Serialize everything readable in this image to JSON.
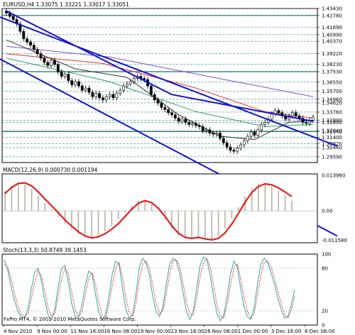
{
  "chart_data": [
    {
      "type": "candlestick",
      "title": "EURUSD,H4  1.33075 1.33221 1.33017 1.33051",
      "price_labels": [
        "1.43430",
        "1.42780",
        "1.41690",
        "1.40990",
        "1.40370",
        "1.39220",
        "1.38230",
        "1.37530",
        "1.36550",
        "1.35700",
        "1.34960",
        "1.34620",
        "1.33760",
        "1.32990",
        "1.32800",
        "1.32040",
        "1.31940",
        "1.31400",
        "1.30820",
        "1.30440",
        "1.29590"
      ],
      "highlighted_labels": [
        "1.42780",
        "1.37530",
        "1.33051",
        "1.31940"
      ],
      "current_price": "1.33051",
      "ylim": [
        1.2905,
        1.4343
      ],
      "x_labels": [
        "4 Nov 2010",
        "9 Nov 00:00",
        "11 Nov 16:00",
        "16 Nov 08:00",
        "19 Nov 00:00",
        "23 Nov 16:00",
        "26 Nov 08:00",
        "1 Dec 00:00",
        "3 Dec 16:00",
        "8 Dec 08:00"
      ],
      "close_series": [
        1.43,
        1.427,
        1.424,
        1.42,
        1.413,
        1.406,
        1.403,
        1.4,
        1.396,
        1.392,
        1.388,
        1.384,
        1.381,
        1.386,
        1.382,
        1.375,
        1.371,
        1.373,
        1.367,
        1.363,
        1.366,
        1.362,
        1.358,
        1.36,
        1.356,
        1.352,
        1.355,
        1.351,
        1.349,
        1.352,
        1.354,
        1.351,
        1.355,
        1.358,
        1.362,
        1.364,
        1.366,
        1.369,
        1.371,
        1.369,
        1.368,
        1.362,
        1.354,
        1.349,
        1.346,
        1.342,
        1.34,
        1.337,
        1.335,
        1.332,
        1.329,
        1.331,
        1.328,
        1.326,
        1.327,
        1.325,
        1.324,
        1.32,
        1.321,
        1.318,
        1.317,
        1.318,
        1.313,
        1.309,
        1.305,
        1.302,
        1.301,
        1.304,
        1.307,
        1.311,
        1.315,
        1.319,
        1.316,
        1.321,
        1.326,
        1.328,
        1.331,
        1.336,
        1.339,
        1.337,
        1.334,
        1.331,
        1.334,
        1.337,
        1.334,
        1.332,
        1.328,
        1.327,
        1.33,
        1.333
      ],
      "channel_lines": [
        {
          "color": "#1515c8",
          "points": [
            [
              0,
              1.424
            ],
            [
              89,
              1.3145
            ]
          ]
        },
        {
          "color": "#1515c8",
          "points": [
            [
              0,
              1.384
            ],
            [
              53,
              1.2945
            ]
          ]
        },
        {
          "color": "#1515c8",
          "points": [
            [
              0,
              1.432
            ],
            [
              48,
              1.354
            ],
            [
              89,
              1.329
            ]
          ]
        }
      ],
      "moving_averages": [
        {
          "color": "#7a4fd0",
          "points": [
            [
              0,
              1.399
            ],
            [
              30,
              1.389
            ],
            [
              60,
              1.37
            ],
            [
              89,
              1.352
            ]
          ]
        },
        {
          "color": "#d23a3a",
          "points": [
            [
              0,
              1.392
            ],
            [
              28,
              1.383
            ],
            [
              55,
              1.36
            ],
            [
              75,
              1.338
            ],
            [
              89,
              1.332
            ]
          ]
        },
        {
          "color": "#2e9e6b",
          "points": [
            [
              0,
              1.388
            ],
            [
              30,
              1.366
            ],
            [
              55,
              1.338
            ],
            [
              75,
              1.324
            ],
            [
              89,
              1.326
            ]
          ]
        },
        {
          "color": "#333333",
          "points": [
            [
              0,
              1.405
            ],
            [
              20,
              1.378
            ],
            [
              35,
              1.37
            ],
            [
              50,
              1.335
            ],
            [
              62,
              1.315
            ],
            [
              72,
              1.312
            ],
            [
              82,
              1.328
            ],
            [
              89,
              1.33
            ]
          ]
        }
      ]
    },
    {
      "type": "histogram_line",
      "title": "MACD(12,26,9)  0.000730 0.001194",
      "axis_labels": [
        "0.013960",
        "0.00",
        "-0.011580"
      ],
      "ylim": [
        -0.0125,
        0.0145
      ],
      "signal": [
        0.0068,
        0.0092,
        0.0108,
        0.011,
        0.0098,
        0.0074,
        0.0046,
        0.002,
        -0.0008,
        -0.0036,
        -0.006,
        -0.0082,
        -0.0098,
        -0.0106,
        -0.0102,
        -0.009,
        -0.0072,
        -0.005,
        -0.0022,
        0.0006,
        0.003,
        0.004,
        0.0032,
        0.001,
        -0.0022,
        -0.0058,
        -0.0088,
        -0.0104,
        -0.0108,
        -0.0104,
        -0.011,
        -0.0114,
        -0.0108,
        -0.0086,
        -0.0052,
        -0.001,
        0.0034,
        0.0072,
        0.0096,
        0.0106,
        0.0102,
        0.009,
        0.0074,
        0.0056
      ],
      "histogram": [
        0.008,
        0.0098,
        0.011,
        0.0104,
        0.0086,
        0.006,
        0.003,
        0.0005,
        -0.0024,
        -0.005,
        -0.0074,
        -0.0092,
        -0.0104,
        -0.0108,
        -0.0098,
        -0.008,
        -0.006,
        -0.0034,
        -0.0006,
        0.0022,
        0.004,
        0.0044,
        0.0028,
        0.0,
        -0.0036,
        -0.007,
        -0.0096,
        -0.0108,
        -0.011,
        -0.0108,
        -0.0114,
        -0.0112,
        -0.0098,
        -0.0068,
        -0.003,
        0.0014,
        0.0056,
        0.0088,
        0.0106,
        0.0108,
        0.0096,
        0.0078,
        0.006,
        0.004
      ]
    },
    {
      "type": "line",
      "title": "Stoch(13,3,3)  50.8748 39.1453",
      "axis_labels": [
        "100",
        "80",
        "20",
        "0"
      ],
      "levels": [
        80,
        20
      ],
      "ylim": [
        0,
        100
      ],
      "series": [
        {
          "color": "#3aa3a3",
          "values": [
            92,
            78,
            55,
            35,
            20,
            12,
            10,
            22,
            50,
            74,
            80,
            62,
            34,
            14,
            8,
            22,
            55,
            80,
            84,
            60,
            30,
            12,
            10,
            28,
            56,
            76,
            72,
            44,
            18,
            8,
            14,
            40,
            72,
            90,
            86,
            52,
            22,
            10,
            14,
            44,
            82,
            94,
            88,
            70,
            40,
            18,
            12,
            26,
            58,
            86,
            94,
            90,
            72,
            44,
            18,
            8,
            20,
            52,
            84,
            96,
            92,
            70,
            40,
            16,
            6,
            14,
            40,
            72,
            90,
            82,
            52,
            26,
            12,
            8,
            24,
            58,
            86,
            94,
            88,
            74,
            58,
            38,
            22,
            10,
            12,
            28,
            50
          ]
        },
        {
          "color": "#d23a3a",
          "values": [
            86,
            82,
            66,
            46,
            28,
            16,
            12,
            16,
            36,
            60,
            76,
            70,
            48,
            24,
            12,
            16,
            40,
            66,
            80,
            72,
            46,
            22,
            12,
            18,
            42,
            66,
            74,
            58,
            32,
            14,
            10,
            28,
            56,
            80,
            88,
            68,
            38,
            18,
            12,
            30,
            64,
            86,
            90,
            80,
            56,
            30,
            16,
            20,
            44,
            72,
            90,
            92,
            82,
            58,
            32,
            14,
            14,
            38,
            68,
            88,
            94,
            82,
            56,
            28,
            12,
            10,
            28,
            56,
            80,
            86,
            66,
            40,
            20,
            10,
            16,
            42,
            70,
            88,
            90,
            82,
            66,
            48,
            30,
            16,
            10,
            20,
            40
          ]
        }
      ]
    }
  ],
  "footer": {
    "copyright": "FxPro MT4, © 2001-2010 MetaQuotes Software Corp."
  }
}
